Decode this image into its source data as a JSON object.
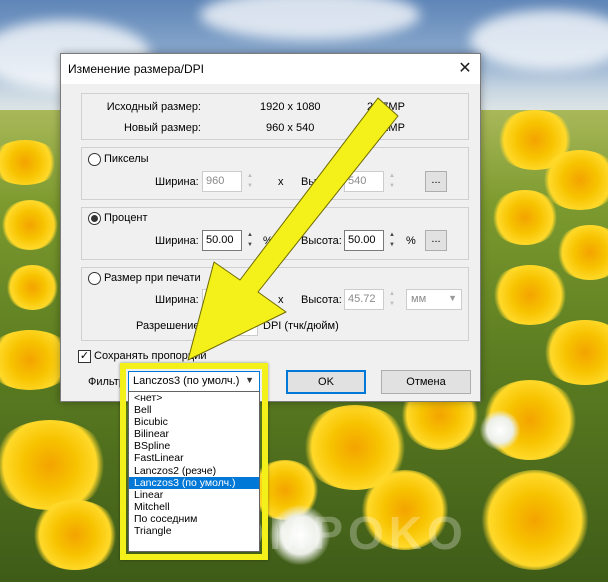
{
  "dialog": {
    "title": "Изменение размера/DPI",
    "close_glyph": "✕",
    "info": {
      "original_label": "Исходный размер:",
      "original_dims": "1920 x 1080",
      "original_mp": "2.07MP",
      "new_label": "Новый размер:",
      "new_dims": "960 x 540",
      "new_mp": "0.52MP"
    },
    "pixels": {
      "radio_label": "Пикселы",
      "width_label": "Ширина:",
      "width_value": "960",
      "x_sep": "x",
      "height_label": "Высота:",
      "height_value": "540",
      "more_button": "..."
    },
    "percent": {
      "radio_label": "Процент",
      "width_label": "Ширина:",
      "width_value": "50.00",
      "width_unit": "%",
      "height_label": "Высота:",
      "height_value": "50.00",
      "height_unit": "%",
      "more_button": "..."
    },
    "print": {
      "radio_label": "Размер при печати",
      "width_label": "Ширина:",
      "width_value": "81",
      "x_sep": "x",
      "height_label": "Высота:",
      "height_value": "45.72",
      "unit_value": "мм",
      "resolution_label": "Разрешение:",
      "resolution_unit": "DPI (тчк/дюйм)"
    },
    "keep_proportions_label": "Сохранять пропорции",
    "filter_label": "Фильтр",
    "ok_button": "OK",
    "cancel_button": "Отмена"
  },
  "filter_dropdown": {
    "selected": "Lanczos3 (по умолч.)",
    "options": [
      "<нет>",
      "Bell",
      "Bicubic",
      "Bilinear",
      "BSpline",
      "FastLinear",
      "Lanczos2 (резче)",
      "Lanczos3 (по умолч.)",
      "Linear",
      "Mitchell",
      "По соседним",
      "Triangle"
    ],
    "selected_index": 7
  },
  "watermark": "KOMPOKO",
  "colors": {
    "highlight": "#f4f01a",
    "selection": "#0078d7",
    "arrow": "#f4f01a"
  }
}
